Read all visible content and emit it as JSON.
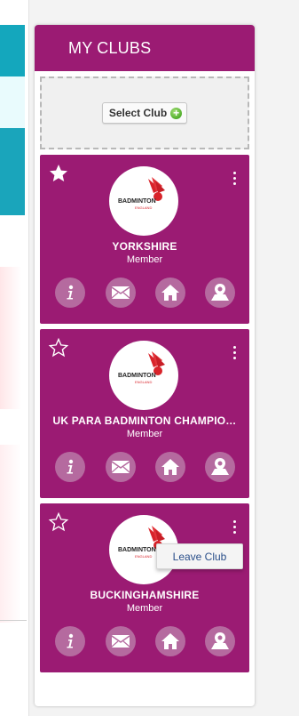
{
  "panel": {
    "title": "MY CLUBS",
    "select_label": "Select Club"
  },
  "colors": {
    "brand": "#9b1b73",
    "action_bg": "#b56a9f"
  },
  "logo_text": {
    "line1": "BADMINTON",
    "line2": "ENGLAND"
  },
  "clubs": [
    {
      "name": "YORKSHIRE",
      "role": "Member",
      "favorite": true
    },
    {
      "name": "UK PARA BADMINTON CHAMPIO…",
      "role": "Member",
      "favorite": false
    },
    {
      "name": "BUCKINGHAMSHIRE",
      "role": "Member",
      "favorite": false
    }
  ],
  "context_menu": {
    "leave_label": "Leave Club"
  },
  "icons": {
    "info": "info-icon",
    "mail": "mail-icon",
    "home": "home-icon",
    "map": "map-pin-icon",
    "star_filled": "star-filled-icon",
    "star_outline": "star-outline-icon",
    "menu": "kebab-menu-icon",
    "add": "plus-circle-icon"
  }
}
